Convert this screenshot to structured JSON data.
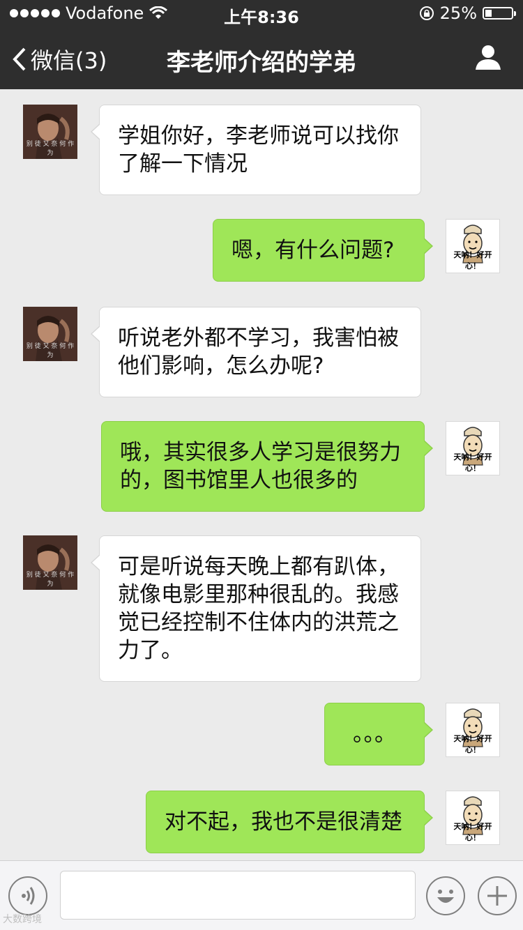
{
  "status_bar": {
    "carrier": "Vodafone",
    "time": "上午8:36",
    "battery_percent": "25%",
    "battery_level": 0.25
  },
  "nav": {
    "back_label": "微信(3)",
    "title": "李老师介绍的学弟"
  },
  "messages": [
    {
      "from": "them",
      "text": "学姐你好，李老师说可以找你了解一下情况"
    },
    {
      "from": "me",
      "text": "嗯，有什么问题?"
    },
    {
      "from": "them",
      "text": "听说老外都不学习，我害怕被他们影响，怎么办呢?"
    },
    {
      "from": "me",
      "text": "哦，其实很多人学习是很努力的，图书馆里人也很多的"
    },
    {
      "from": "them",
      "text": "可是听说每天晚上都有趴体，就像电影里那种很乱的。我感觉已经控制不住体内的洪荒之力了。"
    },
    {
      "from": "me",
      "text": "。。。"
    },
    {
      "from": "me",
      "text": "对不起，我也不是很清楚"
    }
  ],
  "avatars": {
    "them_caption": "别 徒 又 奈 何 作 为",
    "me_caption": "天呐！好开心！"
  },
  "input_bar": {
    "text_value": "",
    "icons": [
      "voice-icon",
      "emoji-icon",
      "plus-icon"
    ]
  },
  "watermark": "大数跨境",
  "colors": {
    "bar_bg": "#2e2e2e",
    "chat_bg": "#ebebeb",
    "outgoing_bubble": "#9fe658",
    "incoming_bubble": "#ffffff"
  }
}
